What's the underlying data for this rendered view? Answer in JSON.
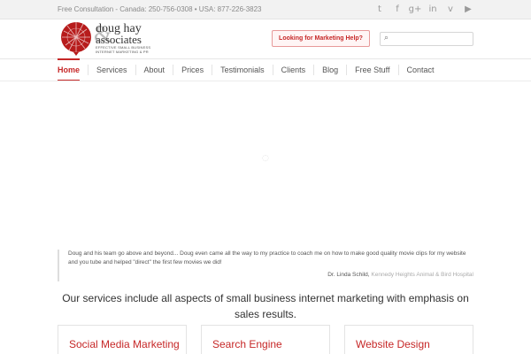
{
  "topbar": {
    "contact": "Free Consultation - Canada: 250-756-0308 • USA: 877-226-3823",
    "social": [
      {
        "icon": "twitter-icon",
        "glyph": "t"
      },
      {
        "icon": "facebook-icon",
        "glyph": "f"
      },
      {
        "icon": "google-plus-icon",
        "glyph": "g+"
      },
      {
        "icon": "linkedin-icon",
        "glyph": "in"
      },
      {
        "icon": "vimeo-icon",
        "glyph": "v"
      },
      {
        "icon": "youtube-icon",
        "glyph": "▶"
      }
    ]
  },
  "header": {
    "logo_name1": "doug hay",
    "logo_name2": "associates",
    "logo_amp": "&",
    "logo_tag1": "EFFECTIVE SMALL BUSINESS",
    "logo_tag2": "INTERNET MARKETING & PR",
    "cta_label": "Looking for Marketing Help?",
    "search_placeholder": "",
    "accent_color": "#c62828"
  },
  "nav": {
    "items": [
      "Home",
      "Services",
      "About",
      "Prices",
      "Testimonials",
      "Clients",
      "Blog",
      "Free Stuff",
      "Contact"
    ],
    "active": "Home"
  },
  "testimonial": {
    "text": "Doug and his team go above and beyond... Doug even came all the way to my practice to coach me on how to make good quality movie clips for my website and you tube and helped \"direct\" the first few movies we did!",
    "author": "Dr. Linda Schild, ",
    "organization": "Kennedy Heights Animal & Bird Hospital"
  },
  "services": {
    "tagline": "Our services include all aspects of small business internet marketing with emphasis on sales results.",
    "boxes": [
      "Social Media Marketing",
      "Search Engine",
      "Website Design"
    ]
  }
}
